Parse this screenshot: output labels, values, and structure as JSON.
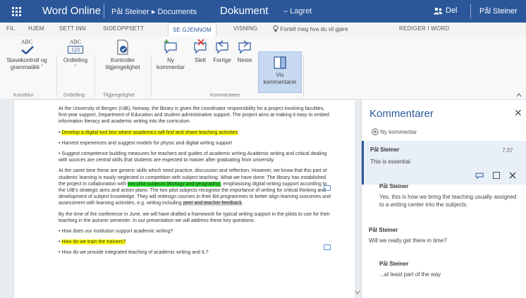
{
  "titlebar": {
    "app_name": "Word Online",
    "breadcrumb": "Pål Steiner ▸ Documents",
    "doc_name": "Dokument",
    "save_status": "–  Lagret",
    "share_label": "Del",
    "user_name": "Pål Steiner",
    "colors": {
      "accent": "#2b579a"
    }
  },
  "tabs": [
    {
      "label": "FIL"
    },
    {
      "label": "HJEM"
    },
    {
      "label": "SETT INN"
    },
    {
      "label": "SIDEOPPSETT"
    },
    {
      "label": "SE GJENNOM"
    },
    {
      "label": "VISNING"
    },
    {
      "label": "REDIGER I WORD"
    }
  ],
  "tell_me": "Fortell meg hva du vil gjøre",
  "ribbon": {
    "spell_line1": "Stavekontroll og",
    "spell_line2": "grammatikk ˇ",
    "spell_icon_text": "ABC",
    "wordcount_line1": "Ordtelling",
    "wordcount_line2": "ˇ",
    "wordcount_icon_text": "ABC",
    "wordcount_icon_num": "123",
    "access_line1": "Kontroller",
    "access_line2": "tilgjengelighet",
    "new_comment_line1": "Ny",
    "new_comment_line2": "kommentar",
    "delete_label": "Slett",
    "prev_label": "Forrige",
    "next_label": "Neste",
    "show_line1": "Vis",
    "show_line2": "kommentarer",
    "group_korrektur": "Korrektur",
    "group_ordtelling": "Ordtelling",
    "group_tilgjengelighet": "Tilgjengelighet",
    "group_kommentarer": "Kommentarer"
  },
  "document": {
    "p1": "At the University of Bergen (UiB), Norway, the library is given the coordinator responsibility for a project involving faculties, first-year support, Department of Education and student administrative support. The project aims at making it easy to embed information literacy and academic writing into the curriculum.",
    "b1": "Develop a digital tool box where academics will find and share teaching activities",
    "b2": "Harvest experiences and suggest models for physic and digital writing support",
    "b3": "Suggest competence building measures for teachers and guides of academic writing Academic writing and critical dealing with sources are central skills that students are expected to master after graduating from university.",
    "p2a": "At the same time these are generic skills which need practice, discussion and reflection. However, we know that this part of students' learning is easily neglected in competition with subject teaching. What we have done: The library has established the project in collaboration with ",
    "p2_hl1": "two pilot subjects (Biology and geography)",
    "p2b": ", emphasising digital writing support according to the UiB's strategic aims and action plans. The two pilot subjects recognise the importance of writing for critical thinking and development of subject knowledge. They will redesign courses in their BA programmes to better align learning outcomes and assessment with learning activities, e.g. writing including ",
    "p2_hl2": "peer and teacher feedback",
    "p2c": ".",
    "p3": "By the time of the conference in June, we will have drafted a framework for typical writing support in the pilots to use for their teaching in the autumn semester. In our presentation we will address these key questions:",
    "q1": "How does our institution support academic writing?",
    "q2": "How do we train the trainers?",
    "q3": "How do we provide integrated teaching of academic writing and IL?"
  },
  "comments_panel": {
    "title": "Kommentarer",
    "new_comment": "Ny kommentar",
    "active": {
      "author": "Pål Steiner",
      "time": "7:37",
      "body": "This is essential"
    },
    "replies": [
      {
        "author": "Pål Steiner",
        "body": "Yes, this is how we bring the teaching usually assigned to a writing center into the subjects."
      },
      {
        "author": "Pål Steiner",
        "body": "Will we really get there in time?"
      },
      {
        "author": "Pål Steiner",
        "body": "...at least part of the way"
      }
    ]
  }
}
